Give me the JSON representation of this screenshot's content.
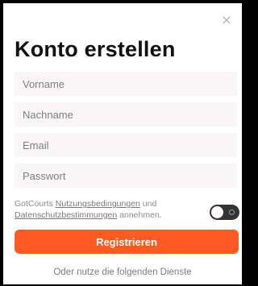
{
  "modal": {
    "title": "Konto erstellen",
    "close_icon": "close-icon"
  },
  "form": {
    "first_name": {
      "placeholder": "Vorname",
      "value": ""
    },
    "last_name": {
      "placeholder": "Nachname",
      "value": ""
    },
    "email": {
      "placeholder": "Email",
      "value": ""
    },
    "password": {
      "placeholder": "Passwort",
      "value": ""
    }
  },
  "terms": {
    "prefix": "GotCourts ",
    "terms_link": "Nutzungsbedingungen",
    "middle": " und ",
    "privacy_link": "Datenschutzbestimmungen",
    "suffix": " annehmen.",
    "accepted": false
  },
  "actions": {
    "register_label": "Registrieren",
    "alternative_text": "Oder nutze die folgenden Dienste"
  },
  "colors": {
    "accent": "#ff5a24",
    "toggle_off": "#333333",
    "field_bg": "#f8f6f6"
  }
}
